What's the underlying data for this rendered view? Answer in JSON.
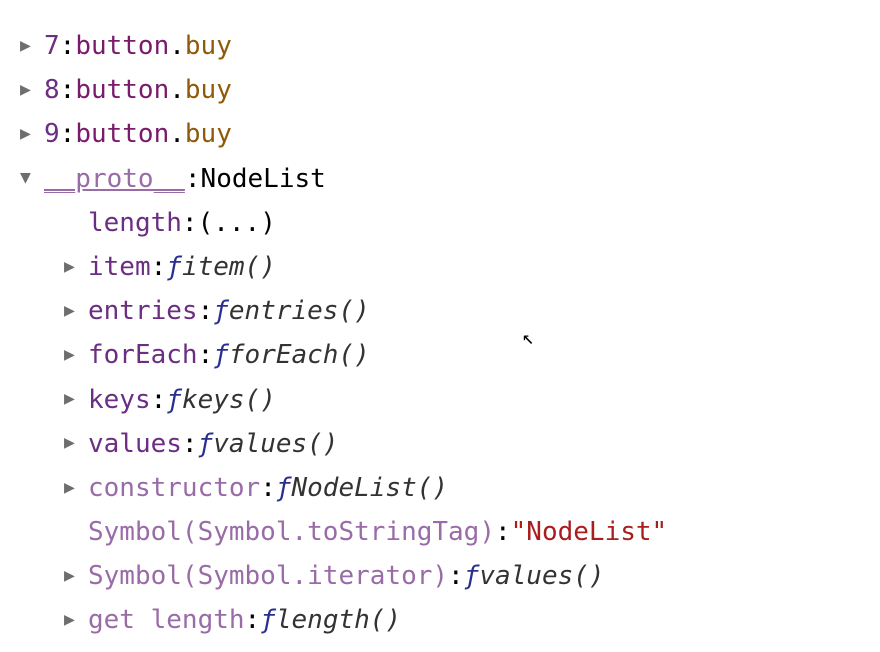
{
  "nodelist_items": [
    {
      "index": "7",
      "tag": "button",
      "class": "buy"
    },
    {
      "index": "8",
      "tag": "button",
      "class": "buy"
    },
    {
      "index": "9",
      "tag": "button",
      "class": "buy"
    }
  ],
  "proto": {
    "label": "__proto__",
    "type": "NodeList",
    "entries": [
      {
        "key": "length",
        "value": "(...)",
        "kind": "getter"
      },
      {
        "key": "item",
        "ftype": "item()",
        "kind": "fn"
      },
      {
        "key": "entries",
        "ftype": "entries()",
        "kind": "fn"
      },
      {
        "key": "forEach",
        "ftype": "forEach()",
        "kind": "fn"
      },
      {
        "key": "keys",
        "ftype": "keys()",
        "kind": "fn"
      },
      {
        "key": "values",
        "ftype": "values()",
        "kind": "fn"
      },
      {
        "key": "constructor",
        "ftype": "NodeList()",
        "kind": "fn",
        "plum": true
      },
      {
        "key": "Symbol(Symbol.toStringTag)",
        "str": "\"NodeList\"",
        "kind": "str",
        "plum": true
      },
      {
        "key": "Symbol(Symbol.iterator)",
        "ftype": "values()",
        "kind": "fn",
        "plum": true
      },
      {
        "key": "get length",
        "ftype": "length()",
        "kind": "fn",
        "plum": true,
        "partial": true
      }
    ]
  },
  "glyphs": {
    "right": "▶",
    "down": "▼",
    "f": "ƒ"
  },
  "colors": {
    "key_purple": "#6b2e82",
    "key_plum": "#9a6ca7",
    "tag": "#7a1a6b",
    "cls": "#8f5a0a",
    "fn": "#2a2f8f",
    "str": "#a81e1e"
  }
}
